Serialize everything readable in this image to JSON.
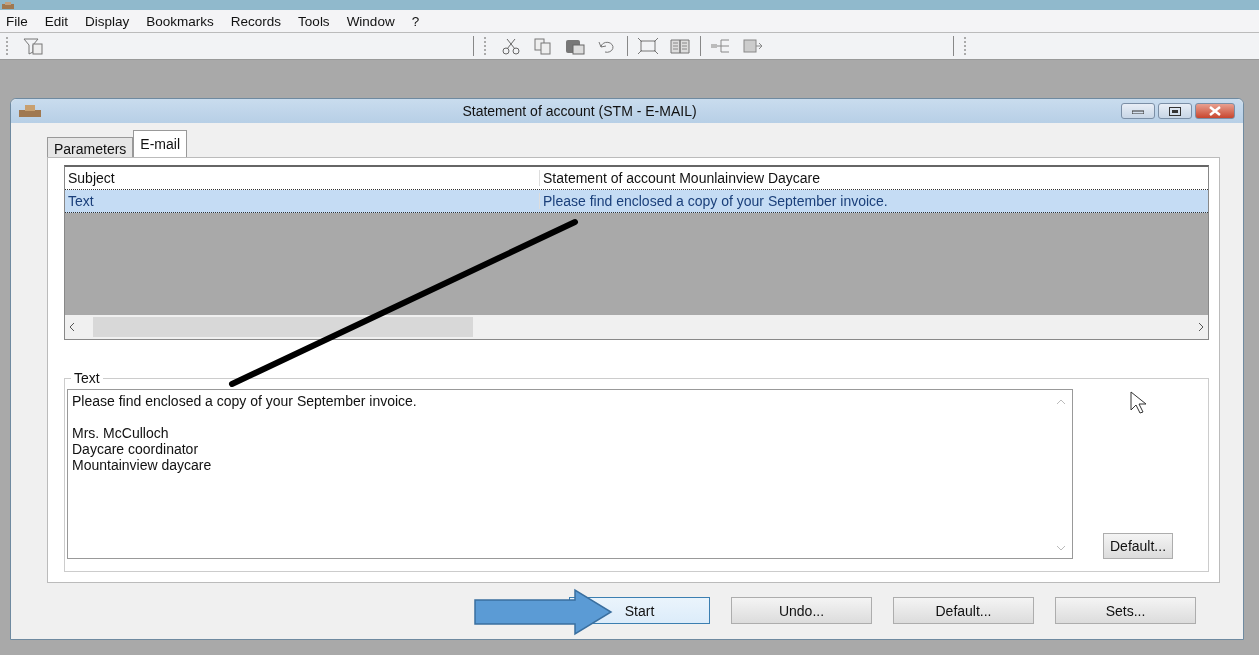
{
  "menu": [
    "File",
    "Edit",
    "Display",
    "Bookmarks",
    "Records",
    "Tools",
    "Window",
    "?"
  ],
  "dialog": {
    "title": "Statement of account (STM - E-MAIL)",
    "tabs": [
      {
        "label": "Parameters",
        "selected": false
      },
      {
        "label": "E-mail",
        "selected": true
      }
    ],
    "rows": [
      {
        "field": "Subject",
        "value": "Statement of account Mounlainview Daycare",
        "selected": false
      },
      {
        "field": "Text",
        "value": "Please find enclosed a copy of your September invoice.",
        "selected": true
      }
    ],
    "text_group": {
      "label": "Text",
      "value": "Please find enclosed a copy of your September invoice.\n\nMrs. McCulloch\nDaycare coordinator\nMountainview daycare",
      "button": "Default..."
    },
    "buttons": [
      {
        "label": "Start",
        "focused": true
      },
      {
        "label": "Undo...",
        "focused": false
      },
      {
        "label": "Default...",
        "focused": false
      },
      {
        "label": "Sets...",
        "focused": false
      }
    ]
  }
}
